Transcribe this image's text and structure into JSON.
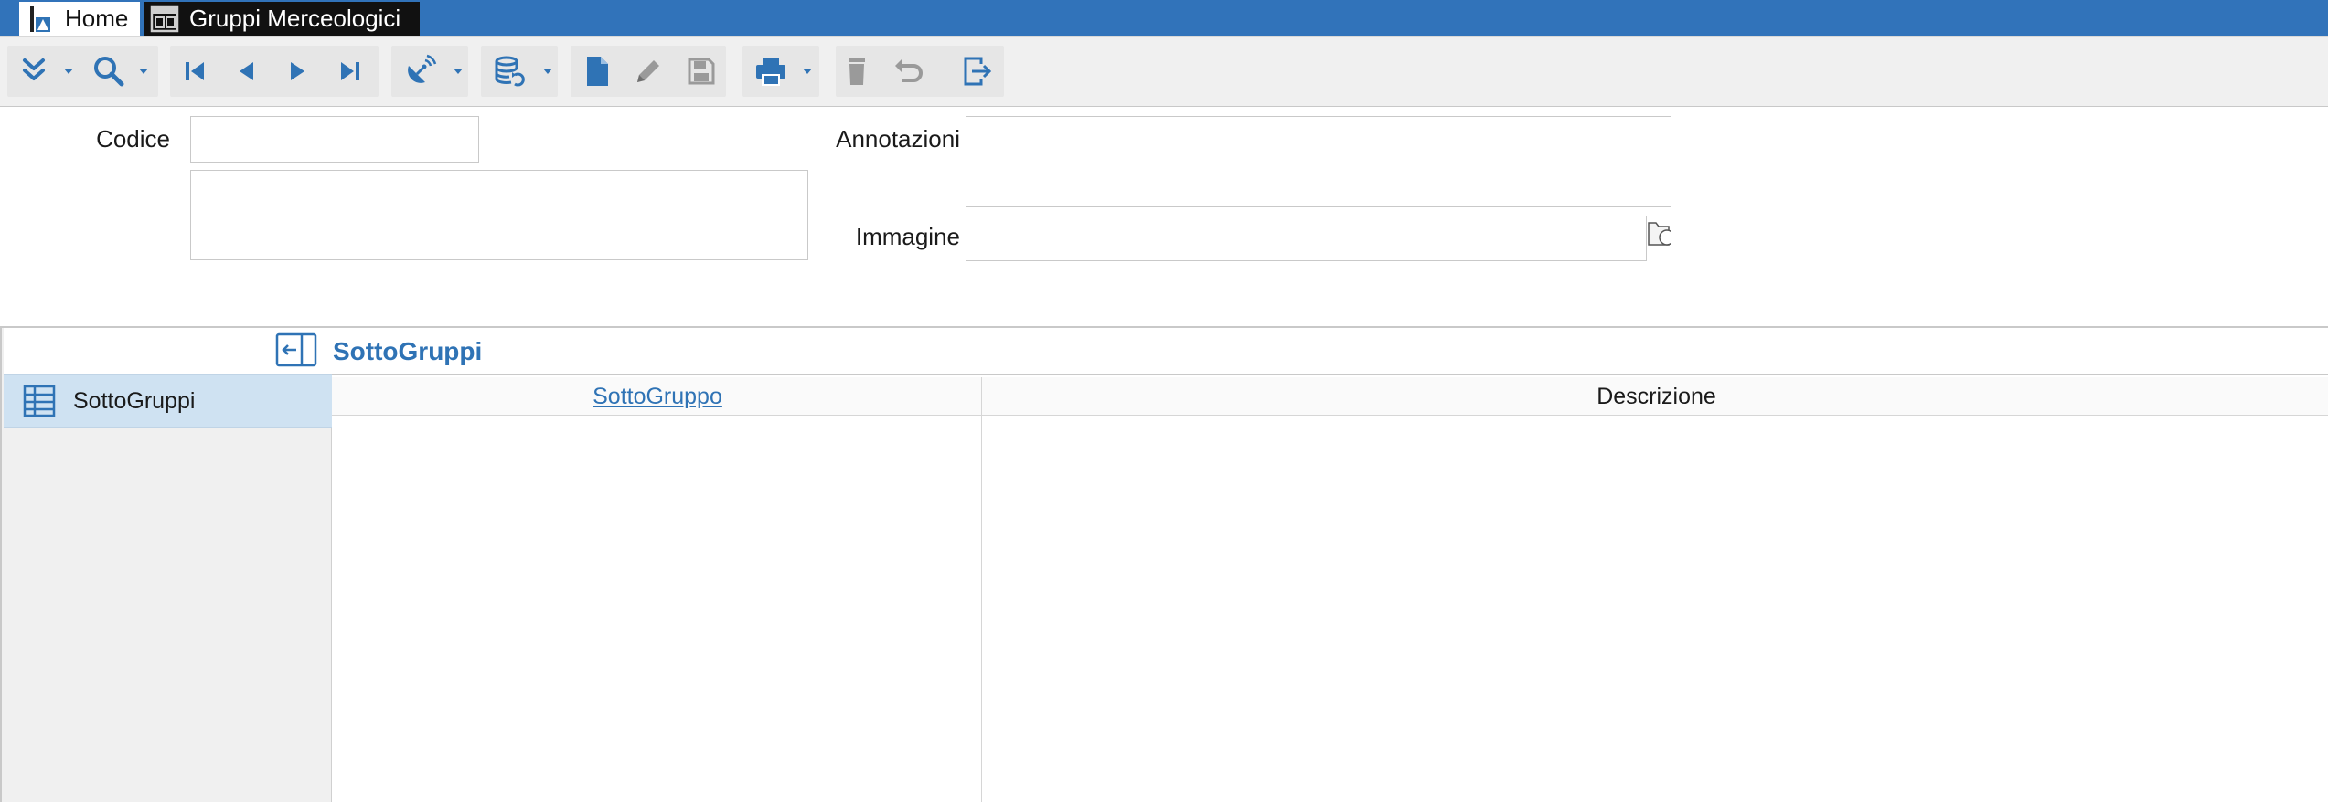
{
  "tabs": [
    {
      "label": "Home"
    },
    {
      "label": "Gruppi Merceologici"
    }
  ],
  "toolbar": {
    "buttons": [
      "expand-icon",
      "search-icon",
      "first-record-icon",
      "previous-record-icon",
      "next-record-icon",
      "last-record-icon",
      "satellite-refresh-icon",
      "database-refresh-icon",
      "new-document-icon",
      "edit-icon",
      "save-icon",
      "print-icon",
      "delete-icon",
      "undo-icon",
      "exit-icon"
    ]
  },
  "form": {
    "codice_label": "Codice",
    "codice_value": "",
    "descrizione_value": "",
    "annotazioni_label": "Annotazioni",
    "annotazioni_value": "",
    "immagine_label": "Immagine",
    "immagine_value": ""
  },
  "sidebar": {
    "items": [
      {
        "label": "SottoGruppi"
      }
    ]
  },
  "section": {
    "title": "SottoGruppi",
    "columns": [
      "SottoGruppo",
      "Descrizione"
    ]
  },
  "colors": {
    "accent": "#2f73b5",
    "tabbar": "#3173ba",
    "selected": "#cfe2f2"
  }
}
